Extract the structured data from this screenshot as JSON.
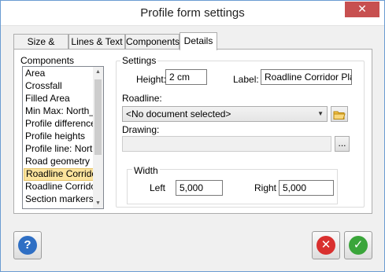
{
  "window": {
    "title": "Profile form settings",
    "close_glyph": "✕"
  },
  "tabs": [
    {
      "label": "Size & Scale"
    },
    {
      "label": "Lines & Text"
    },
    {
      "label": "Components"
    },
    {
      "label": "Details",
      "active": true
    }
  ],
  "components": {
    "label": "Components",
    "items": [
      "Area",
      "Crossfall",
      "Filled Area",
      "Min Max: North_r",
      "Profile difference",
      "Profile heights",
      "Profile line: North",
      "Road geometry",
      "Roadline Corrido",
      "Roadline Corrido",
      "Section markers"
    ],
    "selected_index": 8
  },
  "settings": {
    "label": "Settings",
    "height_label": "Height:",
    "height_value": "2 cm",
    "label_label": "Label:",
    "label_value": "Roadline Corridor Plane",
    "roadline_label": "Roadline:",
    "roadline_value": "<No document selected>",
    "drawing_label": "Drawing:",
    "drawing_value": "",
    "browse_label": "...",
    "width": {
      "label": "Width",
      "left_label": "Left",
      "left_value": "5,000",
      "right_label": "Right",
      "right_value": "5,000"
    }
  },
  "buttons": {
    "help_glyph": "?",
    "cancel_glyph": "✕",
    "ok_glyph": "✓"
  },
  "colors": {
    "help": "#2f6fc4",
    "cancel": "#d9302f",
    "ok": "#3aa53a",
    "selected": "#fbe39d"
  }
}
